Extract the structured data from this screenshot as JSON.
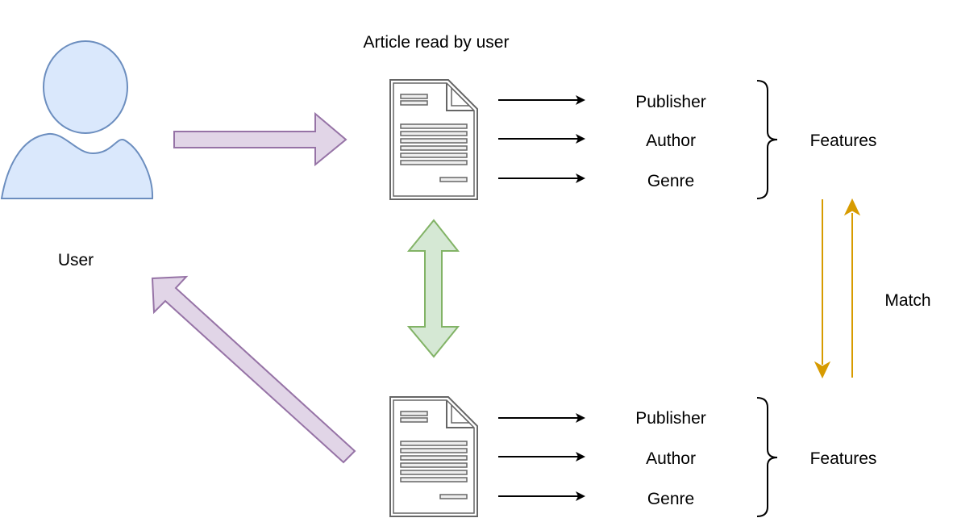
{
  "diagram": {
    "user_label": "User",
    "article_caption": "Article read by user",
    "top_features": {
      "items": [
        "Publisher",
        "Author",
        "Genre"
      ],
      "group_label": "Features"
    },
    "bottom_features": {
      "items": [
        "Publisher",
        "Author",
        "Genre"
      ],
      "group_label": "Features"
    },
    "match_label": "Match"
  },
  "colors": {
    "user_fill": "#dae8fc",
    "user_stroke": "#6c8ebf",
    "purple_fill": "#e1d5e7",
    "purple_stroke": "#9673a6",
    "green_fill": "#d5e8d4",
    "green_stroke": "#82b366",
    "match_arrow": "#d79b00",
    "doc_stroke": "#666666"
  }
}
